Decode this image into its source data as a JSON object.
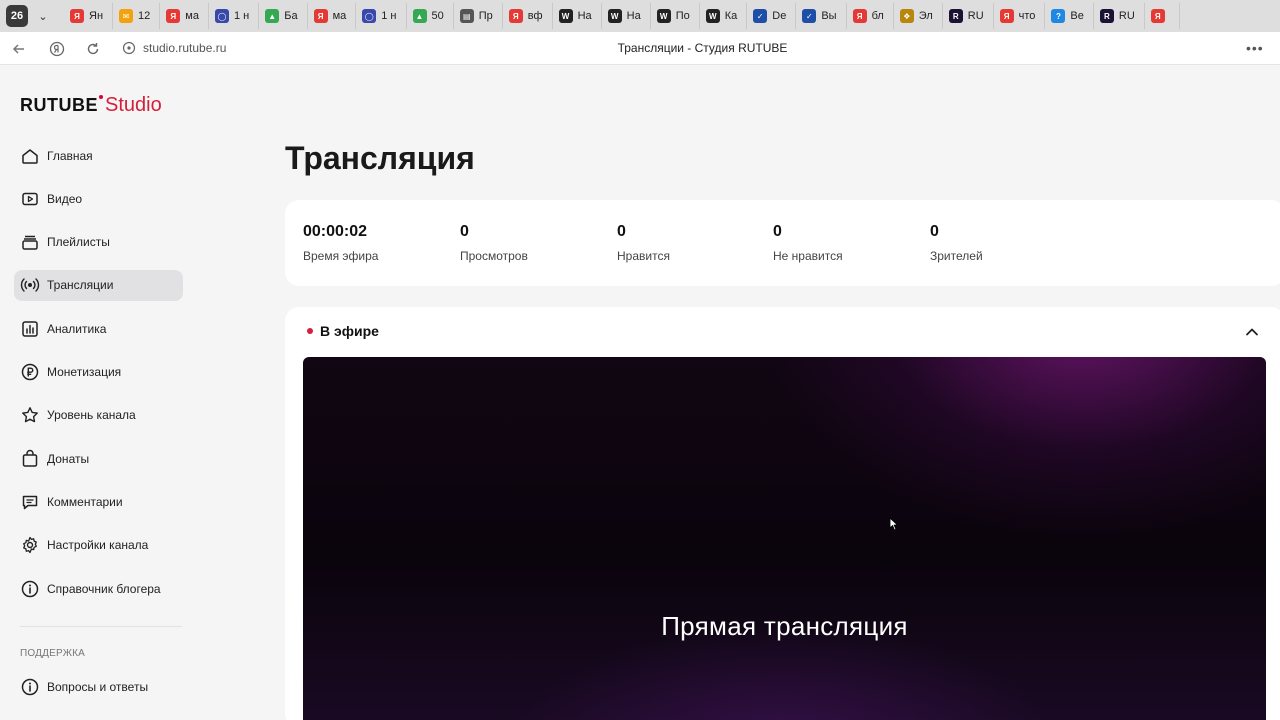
{
  "browser": {
    "tab_counter": "26",
    "tabs": [
      {
        "label": "Ян",
        "icon": "yandex-icon",
        "color": "#e53935",
        "glyph": "Я"
      },
      {
        "label": "12",
        "icon": "mail-icon",
        "color": "#f2a20c",
        "glyph": "✉"
      },
      {
        "label": "ма",
        "icon": "yandex-icon",
        "color": "#e53935",
        "glyph": "Я"
      },
      {
        "label": "1 н",
        "icon": "ring-icon",
        "color": "#3949ab",
        "glyph": "◯"
      },
      {
        "label": "Ба",
        "icon": "drive-icon",
        "color": "#34a853",
        "glyph": "▲"
      },
      {
        "label": "ма",
        "icon": "yandex-icon",
        "color": "#e53935",
        "glyph": "Я"
      },
      {
        "label": "1 н",
        "icon": "ring-icon",
        "color": "#3949ab",
        "glyph": "◯"
      },
      {
        "label": "50",
        "icon": "drive-icon",
        "color": "#34a853",
        "glyph": "▲"
      },
      {
        "label": "Пр",
        "icon": "doc-icon",
        "color": "#555555",
        "glyph": "▤"
      },
      {
        "label": "вф",
        "icon": "yandex-icon",
        "color": "#e53935",
        "glyph": "Я"
      },
      {
        "label": "На",
        "icon": "wiki-icon",
        "color": "#222222",
        "glyph": "W"
      },
      {
        "label": "На",
        "icon": "wiki-icon",
        "color": "#222222",
        "glyph": "W"
      },
      {
        "label": "По",
        "icon": "wiki-icon",
        "color": "#222222",
        "glyph": "W"
      },
      {
        "label": "Ка",
        "icon": "wiki-icon",
        "color": "#222222",
        "glyph": "W"
      },
      {
        "label": "De",
        "icon": "deepl-icon",
        "color": "#1e4fa8",
        "glyph": "✓"
      },
      {
        "label": "Вы",
        "icon": "deepl-icon",
        "color": "#1e4fa8",
        "glyph": "✓"
      },
      {
        "label": "бл",
        "icon": "yandex-icon",
        "color": "#e53935",
        "glyph": "Я"
      },
      {
        "label": "Эл",
        "icon": "emblem-icon",
        "color": "#b8860b",
        "glyph": "❖"
      },
      {
        "label": "RU",
        "icon": "rutube-icon",
        "color": "#1b1235",
        "glyph": "R"
      },
      {
        "label": "что",
        "icon": "yandex-icon",
        "color": "#e53935",
        "glyph": "Я"
      },
      {
        "label": "Ве",
        "icon": "question-icon",
        "color": "#1e88e5",
        "glyph": "?"
      },
      {
        "label": "RU",
        "icon": "rutube-icon",
        "color": "#1b1235",
        "glyph": "R"
      },
      {
        "label": "",
        "icon": "yandex-icon",
        "color": "#e53935",
        "glyph": "Я"
      }
    ],
    "url": "studio.rutube.ru",
    "page_title": "Трансляции - Студия RUTUBE"
  },
  "sidebar": {
    "logo_brand": "RUTUBE",
    "logo_suffix": "Studio",
    "items": [
      {
        "label": "Главная",
        "icon": "home-icon"
      },
      {
        "label": "Видео",
        "icon": "video-icon"
      },
      {
        "label": "Плейлисты",
        "icon": "playlist-icon"
      },
      {
        "label": "Трансляции",
        "icon": "broadcast-icon",
        "active": true
      },
      {
        "label": "Аналитика",
        "icon": "analytics-icon"
      },
      {
        "label": "Монетизация",
        "icon": "ruble-icon"
      },
      {
        "label": "Уровень канала",
        "icon": "star-icon"
      },
      {
        "label": "Донаты",
        "icon": "gift-icon"
      },
      {
        "label": "Комментарии",
        "icon": "comment-icon"
      },
      {
        "label": "Настройки канала",
        "icon": "gear-icon"
      },
      {
        "label": "Справочник блогера",
        "icon": "info-icon"
      }
    ],
    "support_label": "ПОДДЕРЖКА",
    "support_items": [
      {
        "label": "Вопросы и ответы",
        "icon": "help-icon"
      }
    ]
  },
  "main": {
    "title": "Трансляция",
    "stats": [
      {
        "value": "00:00:02",
        "label": "Время эфира"
      },
      {
        "value": "0",
        "label": "Просмотров"
      },
      {
        "value": "0",
        "label": "Нравится"
      },
      {
        "value": "0",
        "label": "Не нравится"
      },
      {
        "value": "0",
        "label": "Зрителей"
      }
    ],
    "live_label": "В эфире",
    "player_text": "Прямая трансляция"
  },
  "colors": {
    "accent": "#d41f3b",
    "active_nav_bg": "#e1e1e4",
    "page_bg": "#f5f5f5"
  }
}
